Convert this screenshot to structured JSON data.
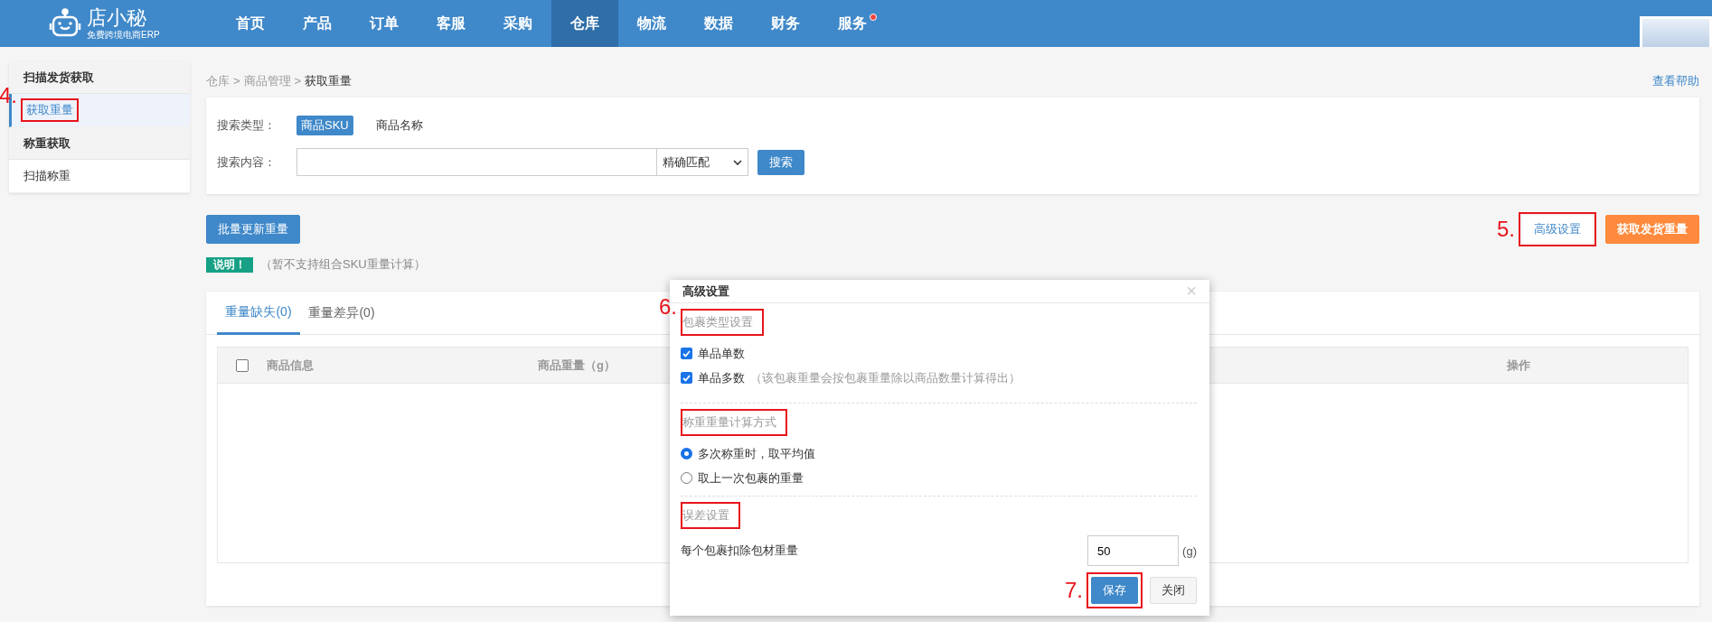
{
  "nav": {
    "logo_title": "店小秘",
    "logo_subtitle": "免费跨境电商ERP",
    "items": [
      {
        "label": "首页",
        "selected": false,
        "badge": false
      },
      {
        "label": "产品",
        "selected": false,
        "badge": false
      },
      {
        "label": "订单",
        "selected": false,
        "badge": false
      },
      {
        "label": "客服",
        "selected": false,
        "badge": false
      },
      {
        "label": "采购",
        "selected": false,
        "badge": false
      },
      {
        "label": "仓库",
        "selected": true,
        "badge": false
      },
      {
        "label": "物流",
        "selected": false,
        "badge": false
      },
      {
        "label": "数据",
        "selected": false,
        "badge": false
      },
      {
        "label": "财务",
        "selected": false,
        "badge": false
      },
      {
        "label": "服务",
        "selected": false,
        "badge": true
      }
    ]
  },
  "sidebar": {
    "groups": [
      {
        "title": "扫描发货获取",
        "items": [
          {
            "label": "获取重量",
            "selected": true,
            "boxed": true,
            "callout": "4."
          }
        ]
      },
      {
        "title": "称重获取",
        "items": [
          {
            "label": "扫描称重",
            "selected": false,
            "boxed": false
          }
        ]
      }
    ]
  },
  "breadcrumb": {
    "separator": ">",
    "items": [
      "仓库",
      "商品管理",
      "获取重量"
    ]
  },
  "help_link": "查看帮助",
  "search": {
    "type_label": "搜索类型：",
    "types": [
      {
        "label": "商品SKU",
        "selected": true
      },
      {
        "label": "商品名称",
        "selected": false
      }
    ],
    "content_label": "搜索内容：",
    "match_select": "精确匹配",
    "button": "搜索"
  },
  "actions": {
    "bulk_update": "批量更新重量",
    "advanced": {
      "label": "高级设置",
      "boxed": true,
      "callout": "5."
    },
    "fetch": "获取发货重量"
  },
  "note": {
    "badge": "说明！",
    "text": "（暂不支持组合SKU重量计算）"
  },
  "tabs": [
    {
      "label": "重量缺失(0)",
      "selected": true
    },
    {
      "label": "重量差异(0)",
      "selected": false
    }
  ],
  "table": {
    "select_all_checked": false,
    "columns": [
      "商品信息",
      "商品重量（g）",
      "操作"
    ]
  },
  "dialog": {
    "title": "高级设置",
    "close": "×",
    "sections": [
      {
        "title": "包裹类型设置",
        "boxed": true,
        "callout": "6.",
        "options": [
          {
            "kind": "checkbox",
            "label": "单品单数",
            "checked": true
          },
          {
            "kind": "checkbox",
            "label": "单品多数",
            "hint": "（该包裹重量会按包裹重量除以商品数量计算得出）",
            "checked": true
          }
        ]
      },
      {
        "title": "称重重量计算方式",
        "boxed": true,
        "options": [
          {
            "kind": "radio",
            "label": "多次称重时，取平均值",
            "selected": true
          },
          {
            "kind": "radio",
            "label": "取上一次包裹的重量",
            "selected": false
          }
        ]
      },
      {
        "title": "误差设置",
        "boxed": true,
        "options": [
          {
            "kind": "number",
            "label": "每个包裹扣除包材重量",
            "value": "50",
            "unit": "(g)"
          }
        ]
      }
    ],
    "buttons": [
      {
        "label": "保存",
        "kind": "primary",
        "boxed": true,
        "callout": "7."
      },
      {
        "label": "关闭",
        "kind": "default",
        "boxed": false
      }
    ]
  }
}
